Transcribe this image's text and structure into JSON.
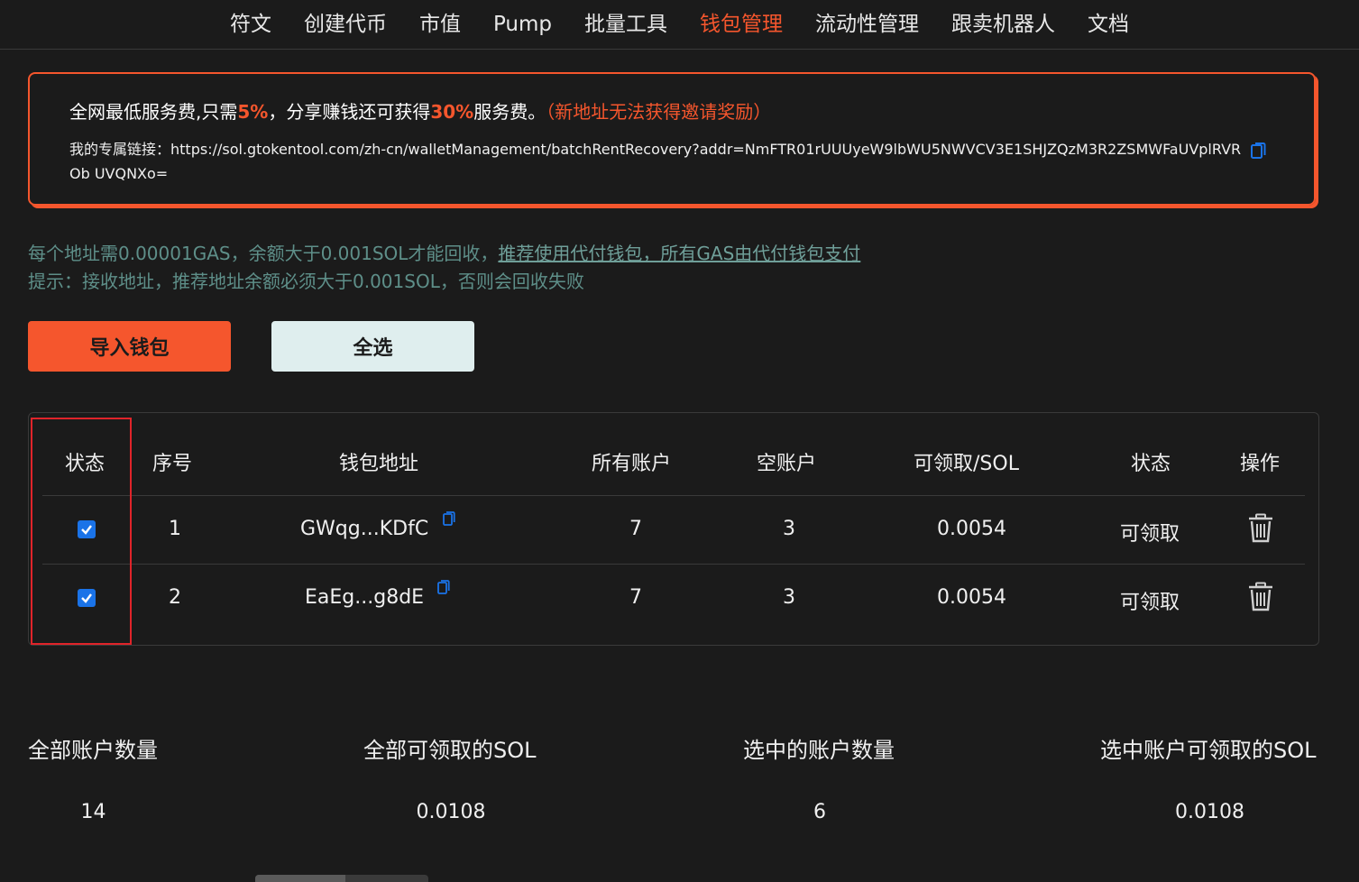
{
  "nav": {
    "items": [
      {
        "label": "符文",
        "active": false
      },
      {
        "label": "创建代币",
        "active": false
      },
      {
        "label": "市值",
        "active": false
      },
      {
        "label": "Pump",
        "active": false
      },
      {
        "label": "批量工具",
        "active": false
      },
      {
        "label": "钱包管理",
        "active": true
      },
      {
        "label": "流动性管理",
        "active": false
      },
      {
        "label": "跟卖机器人",
        "active": false
      },
      {
        "label": "文档",
        "active": false
      }
    ]
  },
  "promo": {
    "text_a": "全网最低服务费,只需",
    "highlight_a": "5%",
    "text_b": "，分享赚钱还可获得",
    "highlight_b": "30%",
    "text_c": "服务费。",
    "note": "（新地址无法获得邀请奖励）",
    "link_label": "我的专属链接：",
    "link_url": "https://sol.gtokentool.com/zh-cn/walletManagement/batchRentRecovery?addr=NmFTR01rUUUyeW9lbWU5NWVCV3E1SHJZQzM3R2ZSMWFaUVplRVROb UVQNXo="
  },
  "hints": {
    "line1_prefix": "每个地址需0.00001GAS，余额大于0.001SOL才能回收，",
    "line1_link": "推荐使用代付钱包，所有GAS由代付钱包支付",
    "line2": "提示：接收地址，推荐地址余额必须大于0.001SOL，否则会回收失败"
  },
  "buttons": {
    "import_label": "导入钱包",
    "select_all_label": "全选"
  },
  "table": {
    "headers": [
      "状态",
      "序号",
      "钱包地址",
      "所有账户",
      "空账户",
      "可领取/SOL",
      "状态",
      "操作"
    ],
    "rows": [
      {
        "checked": true,
        "index": "1",
        "address": "GWqg...KDfC",
        "all_accounts": "7",
        "empty_accounts": "3",
        "claimable": "0.0054",
        "status": "可领取"
      },
      {
        "checked": true,
        "index": "2",
        "address": "EaEg...g8dE",
        "all_accounts": "7",
        "empty_accounts": "3",
        "claimable": "0.0054",
        "status": "可领取"
      }
    ]
  },
  "summary": {
    "total_accounts_label": "全部账户数量",
    "total_accounts_value": "14",
    "total_claimable_label": "全部可领取的SOL",
    "total_claimable_value": "0.0108",
    "selected_accounts_label": "选中的账户数量",
    "selected_accounts_value": "6",
    "selected_claimable_label": "选中账户可领取的SOL",
    "selected_claimable_value": "0.0108"
  },
  "colors": {
    "accent": "#f5562d",
    "checkbox": "#1a73e8",
    "hint": "#5e8f89",
    "highlight_border": "#e0242a"
  },
  "icons": {
    "copy": "copy-icon",
    "delete": "trash-icon"
  }
}
